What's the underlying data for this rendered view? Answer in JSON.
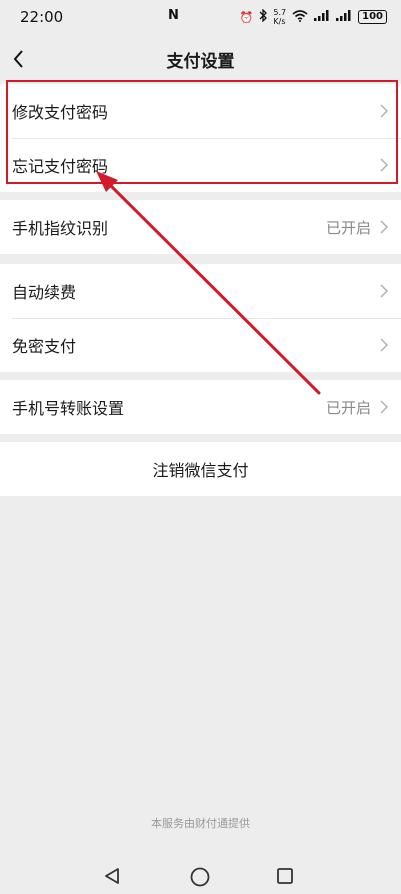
{
  "status_bar": {
    "time": "22:00",
    "nfc_label": "N",
    "net_speed_value": "5.7",
    "net_speed_unit": "K/s",
    "battery": "100"
  },
  "header": {
    "title": "支付设置"
  },
  "groups": [
    {
      "items": [
        {
          "label": "修改支付密码",
          "value": ""
        },
        {
          "label": "忘记支付密码",
          "value": ""
        }
      ]
    },
    {
      "items": [
        {
          "label": "手机指纹识别",
          "value": "已开启"
        }
      ]
    },
    {
      "items": [
        {
          "label": "自动续费",
          "value": ""
        },
        {
          "label": "免密支付",
          "value": ""
        }
      ]
    },
    {
      "items": [
        {
          "label": "手机号转账设置",
          "value": "已开启"
        }
      ]
    },
    {
      "items": [
        {
          "label": "注销微信支付"
        }
      ]
    }
  ],
  "footer": {
    "note": "本服务由财付通提供"
  },
  "annotation": {
    "color": "#d11a2a"
  }
}
